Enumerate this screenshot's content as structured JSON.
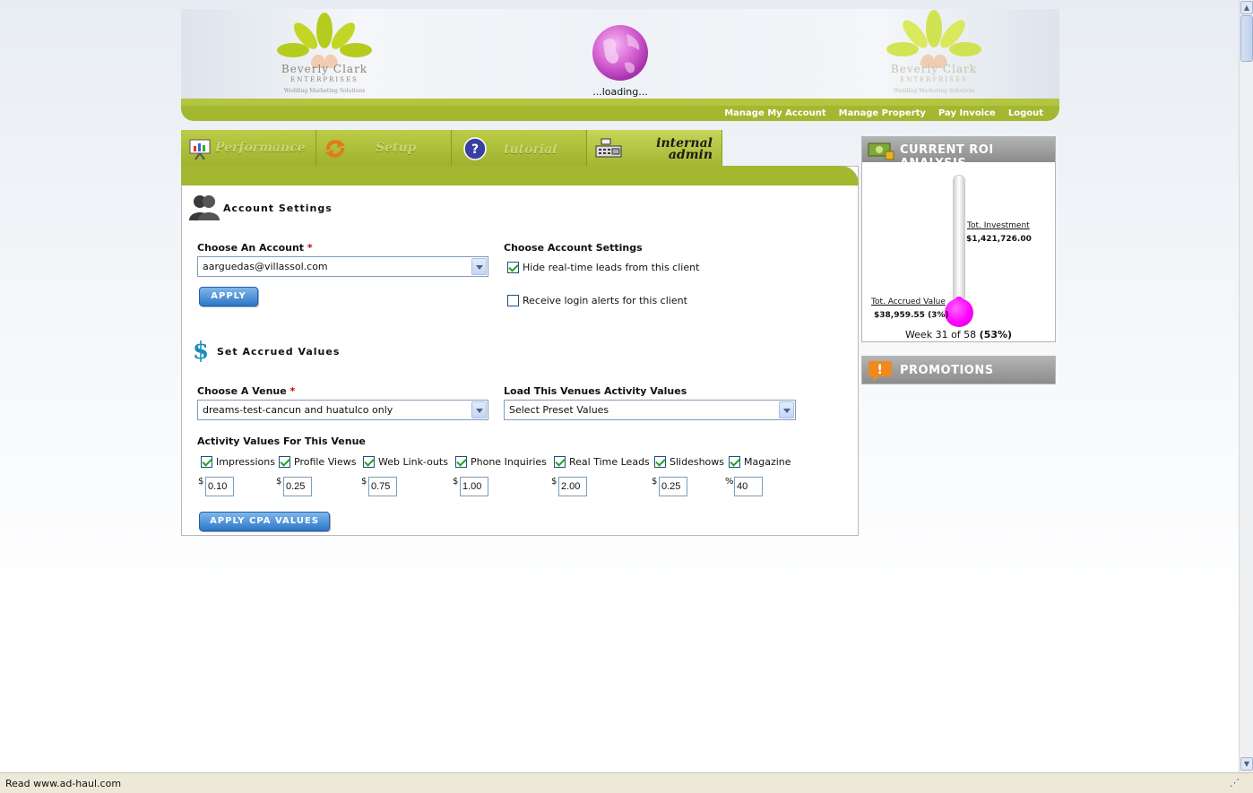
{
  "header": {
    "logo_left": {
      "name": "Beverly Clark",
      "sub": "ENTERPRISES",
      "tagline": "Wedding Marketing Solutions"
    },
    "logo_right": {
      "name": "Beverly Clark",
      "sub": "ENTERPRISES",
      "tagline": "Wedding Marketing Solutions"
    },
    "loading": "...loading...",
    "nav": [
      "Manage My Account",
      "Manage Property",
      "Pay Invoice",
      "Logout"
    ]
  },
  "tabs": [
    {
      "label": "Performance",
      "icon": "presentation-board-icon"
    },
    {
      "label": "Setup",
      "icon": "refresh-arrows-icon"
    },
    {
      "label": "tutorial",
      "icon": "question-mark-icon"
    },
    {
      "label_line1": "internal",
      "label_line2": "admin",
      "icon": "cash-register-icon"
    }
  ],
  "account": {
    "title": "Account Settings",
    "choose_label": "Choose An Account",
    "required_mark": "*",
    "selected_account": "aarguedas@villassol.com",
    "apply_label": "APPLY",
    "settings_label": "Choose Account Settings",
    "settings": [
      {
        "label": "Hide real-time leads from this client",
        "checked": true
      },
      {
        "label": "Receive login alerts for this client",
        "checked": false
      }
    ]
  },
  "accrued": {
    "title": "Set Accrued Values",
    "venue_label": "Choose A Venue",
    "required_mark": "*",
    "selected_venue": "dreams-test-cancun and huatulco only",
    "load_label": "Load This Venues Activity Values",
    "preset_value": "Select Preset Values",
    "activity_label": "Activity Values For This Venue",
    "activities": [
      {
        "label": "Impressions",
        "checked": true,
        "unit": "$",
        "value": "0.10"
      },
      {
        "label": "Profile Views",
        "checked": true,
        "unit": "$",
        "value": "0.25"
      },
      {
        "label": "Web Link-outs",
        "checked": true,
        "unit": "$",
        "value": "0.75"
      },
      {
        "label": "Phone Inquiries",
        "checked": true,
        "unit": "$",
        "value": "1.00"
      },
      {
        "label": "Real Time Leads",
        "checked": true,
        "unit": "$",
        "value": "2.00"
      },
      {
        "label": "Slideshows",
        "checked": true,
        "unit": "$",
        "value": "0.25"
      },
      {
        "label": "Magazine",
        "checked": true,
        "unit": "%",
        "value": "40"
      }
    ],
    "apply_cpa_label": "APPLY CPA VALUES"
  },
  "roi": {
    "title": "CURRENT ROI ANALYSIS",
    "investment_label": "Tot. Investment",
    "investment_value": "$1,421,726.00",
    "accrued_label": "Tot. Accrued Value",
    "accrued_value": "$38,959.55 (3%)",
    "accrued_fraction": 0.03,
    "week_text": "Week 31 of 58",
    "week_pct": "(53%)",
    "accent_color": "#ff00ff"
  },
  "promotions": {
    "title": "PROMOTIONS"
  },
  "statusbar": {
    "text": "Read www.ad-haul.com"
  },
  "colors": {
    "brand_green": "#a3b731",
    "button_blue": "#2c78c9"
  }
}
